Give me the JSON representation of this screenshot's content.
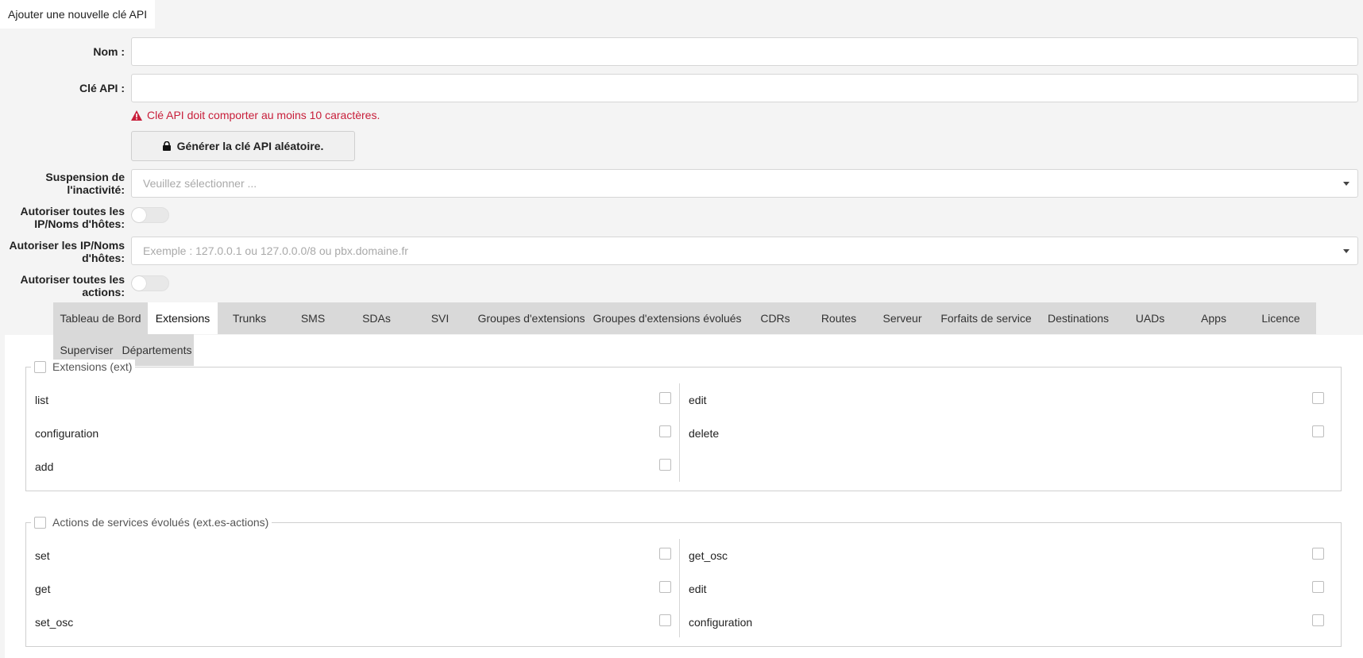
{
  "header": {
    "title": "Ajouter une nouvelle clé API"
  },
  "form": {
    "name_label": "Nom :",
    "name_value": "",
    "apikey_label": "Clé API :",
    "apikey_value": "",
    "apikey_error": "Clé API doit comporter au moins 10 caractères.",
    "generate_button": "Générer la clé API aléatoire.",
    "suspension_label_1": "Suspension de",
    "suspension_label_2": "l'inactivité:",
    "suspension_placeholder": "Veuillez sélectionner ...",
    "allow_all_ips_label_1": "Autoriser toutes les",
    "allow_all_ips_label_2": "IP/Noms d'hôtes:",
    "allow_all_ips_on": false,
    "allow_ips_label_1": "Autoriser les IP/Noms",
    "allow_ips_label_2": "d'hôtes:",
    "allow_ips_placeholder": "Exemple : 127.0.0.1 ou 127.0.0.0/8 ou pbx.domaine.fr",
    "allow_all_actions_label_1": "Autoriser toutes les",
    "allow_all_actions_label_2": "actions:",
    "allow_all_actions_on": false
  },
  "tabs": [
    "Tableau de Bord",
    "Extensions",
    "Trunks",
    "SMS",
    "SDAs",
    "SVI",
    "Groupes d'extensions",
    "Groupes d'extensions évolués",
    "CDRs",
    "Routes",
    "Serveur",
    "Forfaits de service",
    "Destinations",
    "UADs",
    "Apps",
    "Licence",
    "Superviser",
    "Départements"
  ],
  "active_tab": "Extensions",
  "sections": [
    {
      "legend": "Extensions (ext)",
      "left": [
        "list",
        "configuration",
        "add"
      ],
      "right": [
        "edit",
        "delete"
      ]
    },
    {
      "legend": "Actions de services évolués (ext.es-actions)",
      "left": [
        "set",
        "get",
        "set_osc"
      ],
      "right": [
        "get_osc",
        "edit",
        "configuration"
      ]
    }
  ],
  "colors": {
    "error": "#c81e3a",
    "tab_bg": "#d9d9d9",
    "active_tab_bg": "#ffffff",
    "page_bg": "#f4f4f4"
  }
}
